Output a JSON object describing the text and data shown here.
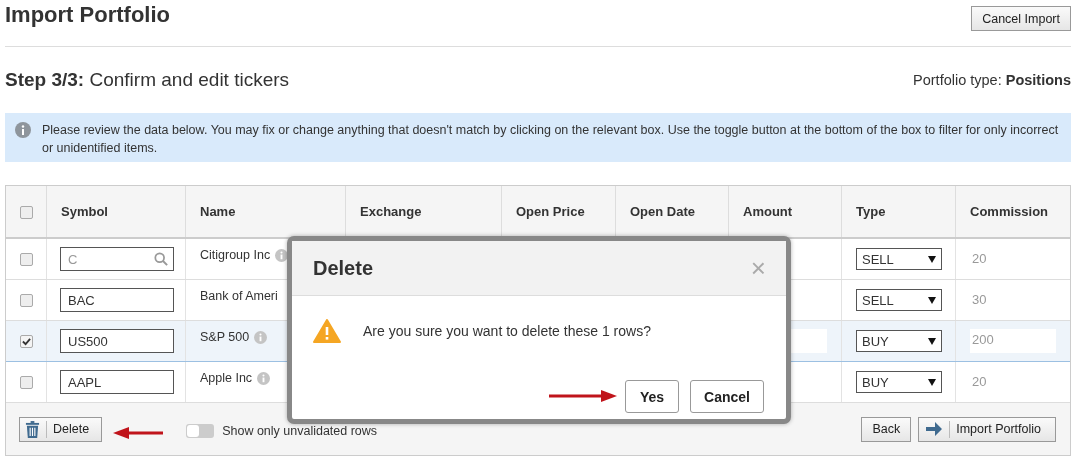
{
  "page": {
    "title": "Import Portfolio",
    "cancel_button": "Cancel Import",
    "step": "**Step 3/3:** Confirm and edit tickers",
    "portfolio_type": "Portfolio type: **Positions**"
  },
  "notice": "Please review the data below. You may fix or change anything that doesn't match by clicking on the relevant box. Use the toggle button at the bottom of the box to filter for only incorrect or unidentified items.",
  "table": {
    "all_checked": false,
    "columns": [
      "Symbol",
      "Name",
      "Exchange",
      "Open Price",
      "Open Date",
      "Amount",
      "Type",
      "Commission"
    ],
    "rows": [
      {
        "checked": false,
        "symbol": "C",
        "kind": "search",
        "name": "Citigroup Inc",
        "info": true,
        "type": "SELL",
        "commission": "20"
      },
      {
        "checked": false,
        "symbol": "BAC",
        "kind": "plain",
        "name": "Bank of Ameri",
        "info": false,
        "type": "SELL",
        "commission": "30"
      },
      {
        "checked": true,
        "symbol": "US500",
        "kind": "plain",
        "name": "S&P 500",
        "info": true,
        "type": "BUY",
        "commission": "200"
      },
      {
        "checked": false,
        "symbol": "AAPL",
        "kind": "plain",
        "name": "Apple Inc",
        "info": true,
        "type": "BUY",
        "commission": "20"
      }
    ]
  },
  "footer": {
    "delete_button": "Delete",
    "toggle": {
      "label": "Show only unvalidated rows",
      "on": false
    },
    "back_button": "Back",
    "import_button": "Import Portfolio"
  },
  "dialog": {
    "title": "Delete",
    "message": "Are you sure you want to delete these 1 rows?",
    "close": "×",
    "buttons": [
      "Yes",
      "Cancel"
    ]
  }
}
